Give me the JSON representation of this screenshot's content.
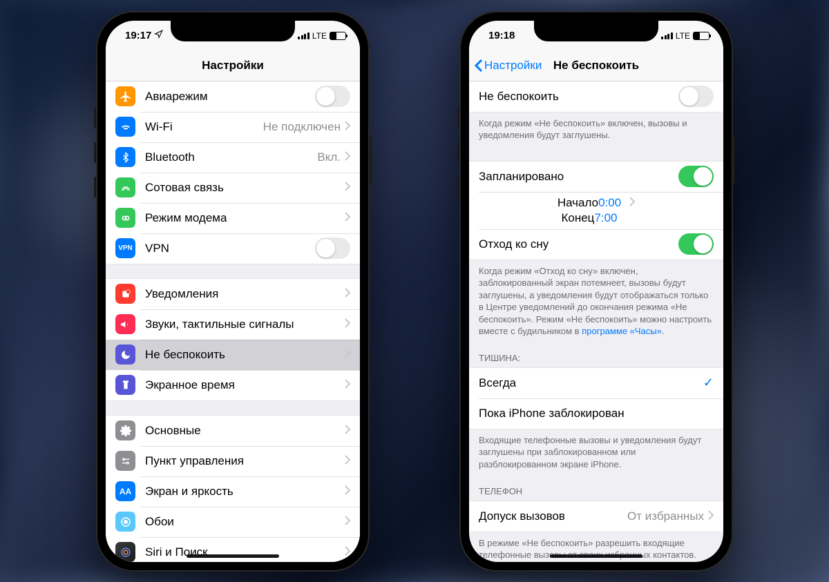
{
  "phone1": {
    "time": "19:17",
    "network": "LTE",
    "title": "Настройки",
    "rows": {
      "airplane": "Авиарежим",
      "wifi": "Wi-Fi",
      "wifi_val": "Не подключен",
      "bluetooth": "Bluetooth",
      "bluetooth_val": "Вкл.",
      "cellular": "Сотовая связь",
      "hotspot": "Режим модема",
      "vpn": "VPN",
      "notifications": "Уведомления",
      "sounds": "Звуки, тактильные сигналы",
      "dnd": "Не беспокоить",
      "screentime": "Экранное время",
      "general": "Основные",
      "control": "Пункт управления",
      "display": "Экран и яркость",
      "wallpaper": "Обои",
      "siri": "Siri и Поиск"
    }
  },
  "phone2": {
    "time": "19:18",
    "network": "LTE",
    "back": "Настройки",
    "title": "Не беспокоить",
    "dnd_label": "Не беспокоить",
    "dnd_footer": "Когда режим «Не беспокоить» включен, вызовы и уведомления будут заглушены.",
    "scheduled": "Запланировано",
    "from_label": "Начало",
    "from_val": "0:00",
    "to_label": "Конец",
    "to_val": "7:00",
    "bedtime": "Отход ко сну",
    "bedtime_footer_a": "Когда режим «Отход ко сну» включен, заблокированный экран потемнеет, вызовы будут заглушены, а уведомления будут отображаться только в Центре уведомлений до окончания режима «Не беспокоить». Режим «Не беспокоить» можно настроить вместе с будильником в ",
    "bedtime_footer_link": "программе «Часы»",
    "silence_header": "ТИШИНА:",
    "silence_always": "Всегда",
    "silence_locked": "Пока iPhone заблокирован",
    "silence_footer": "Входящие телефонные вызовы и уведомления будут заглушены при заблокированном или разблокированном экране iPhone.",
    "phone_header": "ТЕЛЕФОН",
    "allow_calls": "Допуск вызовов",
    "allow_calls_val": "От избранных",
    "allow_footer": "В режиме «Не беспокоить» разрешить входящие телефонные вызовы от своих избранных контактов."
  }
}
